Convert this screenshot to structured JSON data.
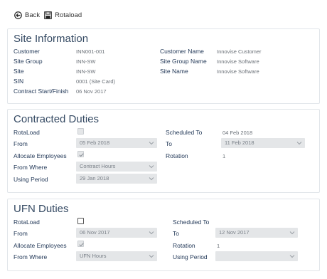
{
  "toolbar": {
    "back_label": "Back",
    "rotaload_label": "Rotaload"
  },
  "site_info": {
    "title": "Site Information",
    "customer_label": "Customer",
    "customer_value": "INN001-001",
    "site_group_label": "Site Group",
    "site_group_value": "INN-SW",
    "site_label": "Site",
    "site_value": "INN-SW",
    "sin_label": "SIN",
    "sin_value": "0001 (Site Card)",
    "contract_label": "Contract Start/Finish",
    "contract_value": "06 Nov 2017",
    "customer_name_label": "Customer Name",
    "customer_name_value": "Innovise Customer",
    "site_group_name_label": "Site Group Name",
    "site_group_name_value": "Innovise Software",
    "site_name_label": "Site Name",
    "site_name_value": "Innovise Software"
  },
  "contracted": {
    "title": "Contracted Duties",
    "rotaload_label": "RotaLoad",
    "rotaload_checked": false,
    "from_label": "From",
    "from_value": "05 Feb 2018",
    "allocate_label": "Allocate Employees",
    "allocate_checked": true,
    "from_where_label": "From Where",
    "from_where_value": "Contract Hours",
    "using_period_label": "Using Period",
    "using_period_value": "29 Jan 2018",
    "scheduled_to_label": "Scheduled To",
    "scheduled_to_value": "04 Feb 2018",
    "to_label": "To",
    "to_value": "11 Feb 2018",
    "rotation_label": "Rotation",
    "rotation_value": "1"
  },
  "ufn": {
    "title": "UFN Duties",
    "rotaload_label": "RotaLoad",
    "rotaload_checked": false,
    "from_label": "From",
    "from_value": "06 Nov 2017",
    "allocate_label": "Allocate Employees",
    "allocate_checked": true,
    "from_where_label": "From Where",
    "from_where_value": "UFN Hours",
    "scheduled_to_label": "Scheduled To",
    "scheduled_to_value": "",
    "to_label": "To",
    "to_value": "12 Nov 2017",
    "rotation_label": "Rotation",
    "rotation_value": "1",
    "using_period_label": "Using Period",
    "using_period_value": ""
  }
}
